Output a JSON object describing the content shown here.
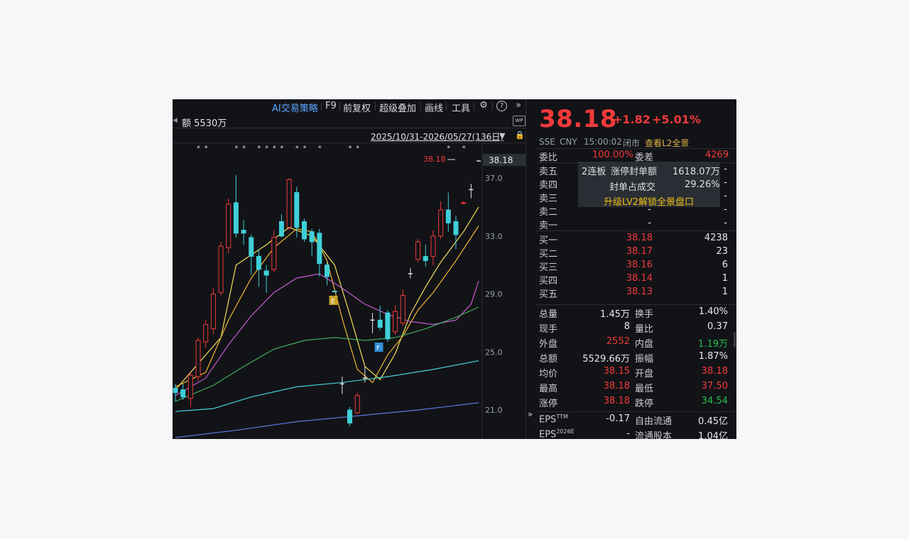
{
  "toolbar": {
    "ai_strategy": "AI交易策略",
    "f9": "F9",
    "adjust": "前复权",
    "overlay": "超级叠加",
    "draw": "画线",
    "tools": "工具"
  },
  "chart_header": {
    "amount": "额 5530万",
    "date_range": "2025/10/31-2026/05/27(136日)",
    "wp_badge": "WP"
  },
  "chart_data": {
    "type": "candlestick",
    "y_ticks": [
      "37.0",
      "33.0",
      "29.0",
      "25.0",
      "21.0"
    ],
    "y_tick_values": [
      37.0,
      33.0,
      29.0,
      25.0,
      21.0
    ],
    "ylim": [
      19.0,
      39.4
    ],
    "last_price_label": "38.18",
    "last_price_annotation": "38.18",
    "markers": [
      {
        "label": "E",
        "color": "#c9a227",
        "after_index": 20
      },
      {
        "label": "F",
        "color": "#2f8fd8",
        "after_index": 26
      }
    ],
    "candles": [
      {
        "o": 22.2,
        "h": 22.8,
        "l": 21.6,
        "c": 22.5,
        "color": "cyan"
      },
      {
        "o": 21.9,
        "h": 22.8,
        "l": 21.7,
        "c": 22.4,
        "color": "cyan"
      },
      {
        "o": 21.8,
        "h": 23.6,
        "l": 21.2,
        "c": 23.4,
        "color": "red"
      },
      {
        "o": 23.3,
        "h": 26.0,
        "l": 23.0,
        "c": 25.8,
        "color": "red"
      },
      {
        "o": 25.7,
        "h": 27.2,
        "l": 25.3,
        "c": 26.9,
        "color": "red"
      },
      {
        "o": 26.6,
        "h": 29.4,
        "l": 26.2,
        "c": 29.0,
        "color": "red"
      },
      {
        "o": 29.1,
        "h": 32.6,
        "l": 28.9,
        "c": 32.3,
        "color": "red"
      },
      {
        "o": 32.2,
        "h": 35.6,
        "l": 31.8,
        "c": 35.2,
        "color": "red"
      },
      {
        "o": 35.3,
        "h": 37.2,
        "l": 32.9,
        "c": 33.2,
        "color": "cyan"
      },
      {
        "o": 33.4,
        "h": 34.1,
        "l": 32.4,
        "c": 33.2,
        "color": "cyan"
      },
      {
        "o": 32.9,
        "h": 33.1,
        "l": 30.3,
        "c": 31.6,
        "color": "cyan"
      },
      {
        "o": 31.6,
        "h": 32.1,
        "l": 29.5,
        "c": 30.7,
        "color": "cyan"
      },
      {
        "o": 30.6,
        "h": 31.0,
        "l": 29.1,
        "c": 30.3,
        "color": "cyan"
      },
      {
        "o": 30.7,
        "h": 33.4,
        "l": 30.5,
        "c": 32.9,
        "color": "red"
      },
      {
        "o": 33.0,
        "h": 34.5,
        "l": 32.9,
        "c": 34.0,
        "color": "cyan"
      },
      {
        "o": 33.6,
        "h": 37.0,
        "l": 33.4,
        "c": 36.9,
        "color": "red"
      },
      {
        "o": 36.0,
        "h": 36.4,
        "l": 32.9,
        "c": 33.6,
        "color": "cyan"
      },
      {
        "o": 34.0,
        "h": 34.2,
        "l": 32.6,
        "c": 32.8,
        "color": "cyan"
      },
      {
        "o": 33.3,
        "h": 33.5,
        "l": 31.6,
        "c": 32.6,
        "color": "cyan"
      },
      {
        "o": 33.2,
        "h": 33.5,
        "l": 30.2,
        "c": 31.1,
        "color": "cyan"
      },
      {
        "o": 31.0,
        "h": 31.2,
        "l": 29.6,
        "c": 30.2,
        "color": "cyan"
      },
      {
        "o": 29.2,
        "h": 29.2,
        "l": 29.2,
        "c": 29.2,
        "color": "cyan"
      },
      {
        "o": 22.8,
        "h": 23.3,
        "l": 22.1,
        "c": 22.8,
        "color": "white"
      },
      {
        "o": 21.0,
        "h": 21.2,
        "l": 19.9,
        "c": 20.1,
        "color": "cyan"
      },
      {
        "o": 20.8,
        "h": 22.2,
        "l": 20.7,
        "c": 22.0,
        "color": "red"
      },
      {
        "o": 23.2,
        "h": 24.0,
        "l": 22.9,
        "c": 23.2,
        "color": "white"
      },
      {
        "o": 27.2,
        "h": 27.7,
        "l": 26.3,
        "c": 27.2,
        "color": "white"
      },
      {
        "o": 27.2,
        "h": 28.2,
        "l": 26.5,
        "c": 26.7,
        "color": "cyan"
      },
      {
        "o": 27.7,
        "h": 27.9,
        "l": 25.7,
        "c": 25.9,
        "color": "cyan"
      },
      {
        "o": 26.4,
        "h": 28.2,
        "l": 26.2,
        "c": 27.8,
        "color": "red"
      },
      {
        "o": 27.0,
        "h": 29.3,
        "l": 26.8,
        "c": 28.9,
        "color": "red"
      },
      {
        "o": 30.4,
        "h": 30.8,
        "l": 30.1,
        "c": 30.4,
        "color": "white"
      },
      {
        "o": 31.4,
        "h": 32.8,
        "l": 31.2,
        "c": 32.6,
        "color": "red"
      },
      {
        "o": 31.6,
        "h": 32.4,
        "l": 30.9,
        "c": 31.3,
        "color": "cyan"
      },
      {
        "o": 31.6,
        "h": 33.4,
        "l": 31.0,
        "c": 33.0,
        "color": "red"
      },
      {
        "o": 33.0,
        "h": 35.4,
        "l": 32.8,
        "c": 34.8,
        "color": "red"
      },
      {
        "o": 34.8,
        "h": 36.0,
        "l": 33.3,
        "c": 33.9,
        "color": "cyan"
      },
      {
        "o": 34.0,
        "h": 34.4,
        "l": 32.1,
        "c": 33.1,
        "color": "cyan"
      },
      {
        "o": 35.3,
        "h": 35.4,
        "l": 35.2,
        "c": 35.3,
        "color": "red"
      },
      {
        "o": 36.2,
        "h": 36.6,
        "l": 35.6,
        "c": 36.2,
        "color": "white"
      },
      {
        "o": 38.18,
        "h": 38.18,
        "l": 38.18,
        "c": 38.18,
        "color": "white"
      }
    ],
    "ma_lines": [
      {
        "color": "#f5e05a",
        "points": [
          [
            0,
            22.4
          ],
          [
            6,
            26.0
          ],
          [
            8,
            31.0
          ],
          [
            12,
            32.4
          ],
          [
            15,
            33.6
          ],
          [
            18,
            33.0
          ],
          [
            21,
            31.0
          ],
          [
            23,
            27.6
          ],
          [
            25,
            24.0
          ],
          [
            27,
            23.1
          ],
          [
            29,
            24.9
          ],
          [
            31,
            27.6
          ],
          [
            33,
            29.5
          ],
          [
            35,
            31.2
          ],
          [
            38,
            33.3
          ],
          [
            40,
            35.0
          ]
        ]
      },
      {
        "color": "#f2b632",
        "points": [
          [
            0,
            22.6
          ],
          [
            4,
            23.6
          ],
          [
            7,
            27.2
          ],
          [
            10,
            30.1
          ],
          [
            13,
            32.2
          ],
          [
            16,
            33.5
          ],
          [
            18,
            33.3
          ],
          [
            20,
            31.3
          ],
          [
            22,
            27.3
          ],
          [
            24,
            23.8
          ],
          [
            26,
            22.9
          ],
          [
            28,
            24.8
          ],
          [
            30,
            26.1
          ],
          [
            32,
            27.9
          ],
          [
            34,
            29.1
          ],
          [
            37,
            31.3
          ],
          [
            40,
            33.7
          ]
        ]
      },
      {
        "color": "#c45ad0",
        "points": [
          [
            0,
            22.0
          ],
          [
            4,
            23.2
          ],
          [
            7,
            25.5
          ],
          [
            10,
            27.5
          ],
          [
            13,
            29.1
          ],
          [
            16,
            30.1
          ],
          [
            19,
            30.4
          ],
          [
            22,
            29.4
          ],
          [
            25,
            28.3
          ],
          [
            28,
            27.6
          ],
          [
            31,
            27.1
          ],
          [
            34,
            26.9
          ],
          [
            37,
            27.2
          ],
          [
            39,
            28.3
          ],
          [
            40,
            29.9
          ]
        ]
      },
      {
        "color": "#3fae5b",
        "points": [
          [
            0,
            21.6
          ],
          [
            5,
            22.7
          ],
          [
            9,
            24.0
          ],
          [
            13,
            25.2
          ],
          [
            17,
            25.8
          ],
          [
            21,
            26.0
          ],
          [
            25,
            25.8
          ],
          [
            29,
            26.0
          ],
          [
            33,
            26.6
          ],
          [
            37,
            27.4
          ],
          [
            40,
            28.1
          ]
        ]
      },
      {
        "color": "#3fcfd8",
        "points": [
          [
            0,
            20.9
          ],
          [
            5,
            21.1
          ],
          [
            10,
            21.9
          ],
          [
            16,
            22.6
          ],
          [
            22,
            22.9
          ],
          [
            28,
            23.3
          ],
          [
            34,
            23.8
          ],
          [
            40,
            24.4
          ]
        ]
      },
      {
        "color": "#5a78e0",
        "points": [
          [
            0,
            19.1
          ],
          [
            8,
            19.6
          ],
          [
            16,
            20.2
          ],
          [
            24,
            20.6
          ],
          [
            32,
            21.0
          ],
          [
            40,
            21.5
          ]
        ]
      }
    ]
  },
  "quote": {
    "price": "38.18",
    "change": "+1.82",
    "change_pct": "+5.01%",
    "exchange": "SSE",
    "currency": "CNY",
    "time": "15:00:02",
    "status": "闭市",
    "l2_link": "查看L2全景"
  },
  "order_book": {
    "weibi_label": "委比",
    "weibi_value": "100.00%",
    "weicha_label": "委差",
    "weicha_value": "4269",
    "asks": [
      {
        "label": "卖五",
        "price": "",
        "vol": "-"
      },
      {
        "label": "卖四",
        "price": "",
        "vol": "-"
      },
      {
        "label": "卖三",
        "price": "",
        "vol": "-"
      },
      {
        "label": "卖二",
        "price": "-",
        "vol": "-"
      },
      {
        "label": "卖一",
        "price": "-",
        "vol": "-"
      }
    ],
    "bids": [
      {
        "label": "买一",
        "price": "38.18",
        "vol": "4238"
      },
      {
        "label": "买二",
        "price": "38.17",
        "vol": "23"
      },
      {
        "label": "买三",
        "price": "38.16",
        "vol": "6"
      },
      {
        "label": "买四",
        "price": "38.14",
        "vol": "1"
      },
      {
        "label": "买五",
        "price": "38.13",
        "vol": "1"
      }
    ]
  },
  "limit_overlay": {
    "streak": "2连板",
    "seal_label": "涨停封单额",
    "seal_value": "1618.07万",
    "ratio_label": "封单占成交",
    "ratio_value": "29.26%",
    "upgrade": "升级LV2解锁全景盘口"
  },
  "stats": [
    {
      "l1": "总量",
      "v1": "1.45万",
      "c1": "wht",
      "l2": "换手",
      "v2": "1.40%",
      "c2": "wht"
    },
    {
      "l1": "现手",
      "v1": "8",
      "c1": "wht",
      "l2": "量比",
      "v2": "0.37",
      "c2": "wht"
    },
    {
      "l1": "外盘",
      "v1": "2552",
      "c1": "red",
      "l2": "内盘",
      "v2": "1.19万",
      "c2": "grn"
    },
    {
      "l1": "总额",
      "v1": "5529.66万",
      "c1": "wht",
      "l2": "振幅",
      "v2": "1.87%",
      "c2": "wht"
    },
    {
      "l1": "均价",
      "v1": "38.15",
      "c1": "red",
      "l2": "开盘",
      "v2": "38.18",
      "c2": "red"
    },
    {
      "l1": "最高",
      "v1": "38.18",
      "c1": "red",
      "l2": "最低",
      "v2": "37.50",
      "c2": "red"
    },
    {
      "l1": "涨停",
      "v1": "38.18",
      "c1": "red",
      "l2": "跌停",
      "v2": "34.54",
      "c2": "grn"
    }
  ],
  "fundamentals": [
    {
      "l1": "EPS",
      "sup1": "TTM",
      "v1": "-0.17",
      "l2": "自由流通",
      "v2": "0.45亿"
    },
    {
      "l1": "EPS",
      "sup1": "2026E",
      "v1": "-",
      "l2": "流通股本",
      "v2": "1.04亿"
    }
  ],
  "colors": {
    "up": "#f23a3a",
    "down_fill": "#3fcfd8",
    "green": "#27c24c",
    "background": "#121317"
  }
}
